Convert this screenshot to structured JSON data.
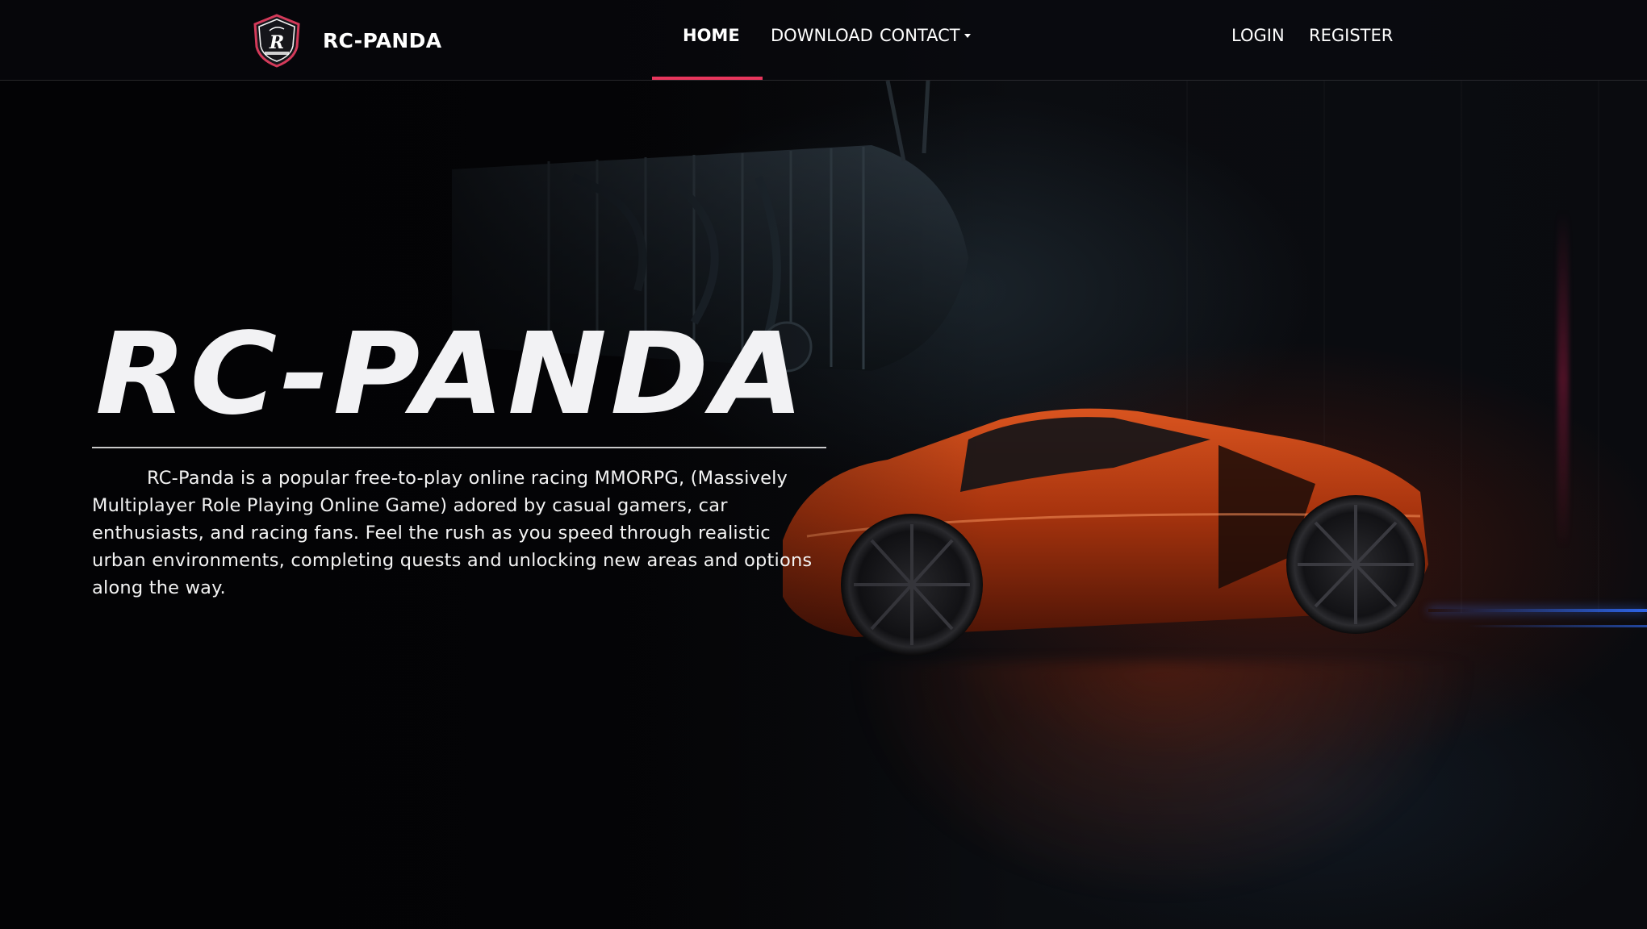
{
  "navbar": {
    "brand_name": "RC-PANDA",
    "links": [
      {
        "label": "HOME",
        "active": true
      },
      {
        "label": "DOWNLOAD",
        "active": false
      },
      {
        "label": "CONTACT",
        "active": false,
        "has_dropdown": true
      }
    ],
    "auth": [
      {
        "label": "LOGIN"
      },
      {
        "label": "REGISTER"
      }
    ],
    "accent_color": "#e8365d"
  },
  "hero": {
    "title": "RC-PANDA",
    "description": "RC-Panda is a popular free-to-play online racing MMORPG, (Massively Multiplayer Role Playing Online Game) adored by casual gamers, car enthusiasts, and racing fans. Feel the rush as you speed through realistic urban environments, completing quests and unlocking new areas and options along the way."
  },
  "logo": {
    "icon": "shield-logo-icon"
  }
}
